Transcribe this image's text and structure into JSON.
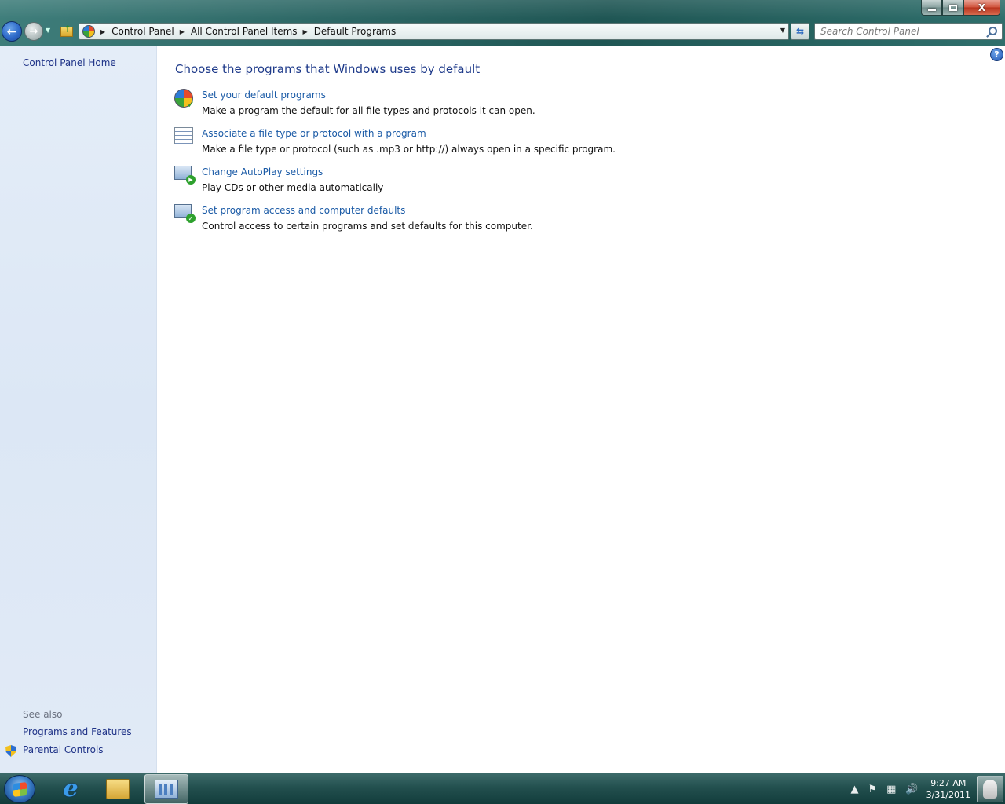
{
  "window": {
    "caption": {
      "minimize": "",
      "maximize": "",
      "close": "X"
    }
  },
  "nav": {
    "back_label": "←",
    "forward_label": "→",
    "dropdown_label": "▼"
  },
  "address": {
    "crumbs": [
      "Control Panel",
      "All Control Panel Items",
      "Default Programs"
    ],
    "separator": "▶",
    "dropdown_label": "▼",
    "refresh_label": "⇆"
  },
  "search": {
    "placeholder": "Search Control Panel"
  },
  "help": {
    "label": "?"
  },
  "left_pane": {
    "home_link": "Control Panel Home",
    "see_also_heading": "See also",
    "see_also_links": [
      "Programs and Features",
      "Parental Controls"
    ]
  },
  "main": {
    "title": "Choose the programs that Windows uses by default",
    "tasks": [
      {
        "link": "Set your default programs",
        "description": "Make a program the default for all file types and protocols it can open."
      },
      {
        "link": "Associate a file type or protocol with a program",
        "description": "Make a file type or protocol (such as .mp3 or http://) always open in a specific program."
      },
      {
        "link": "Change AutoPlay settings",
        "description": "Play CDs or other media automatically"
      },
      {
        "link": "Set program access and computer defaults",
        "description": "Control access to certain programs and set defaults for this computer."
      }
    ]
  },
  "taskbar": {
    "ie_label": "e",
    "tray": {
      "up_arrow": "▲",
      "flag": "⚑",
      "network": "▦",
      "volume": "🔊",
      "time": "9:27 AM",
      "date": "3/31/2011"
    }
  }
}
